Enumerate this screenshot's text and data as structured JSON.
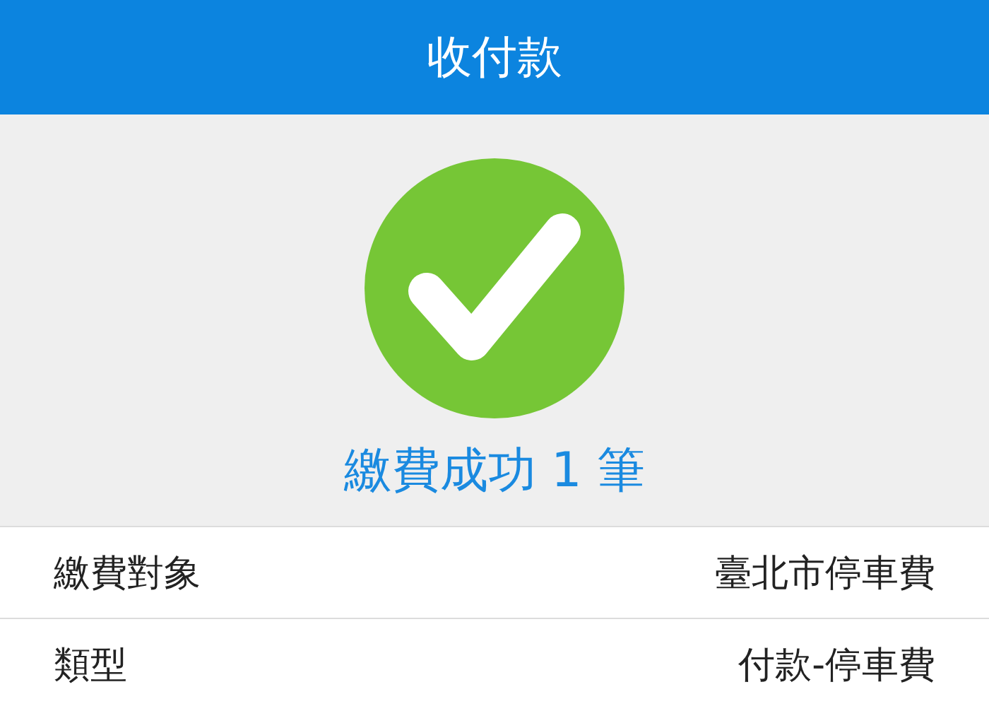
{
  "header": {
    "title": "收付款"
  },
  "result": {
    "success": true,
    "message": "繳費成功 1 筆"
  },
  "details": [
    {
      "label": "繳費對象",
      "value": "臺北市停車費"
    },
    {
      "label": "類型",
      "value": "付款-停車費"
    }
  ]
}
